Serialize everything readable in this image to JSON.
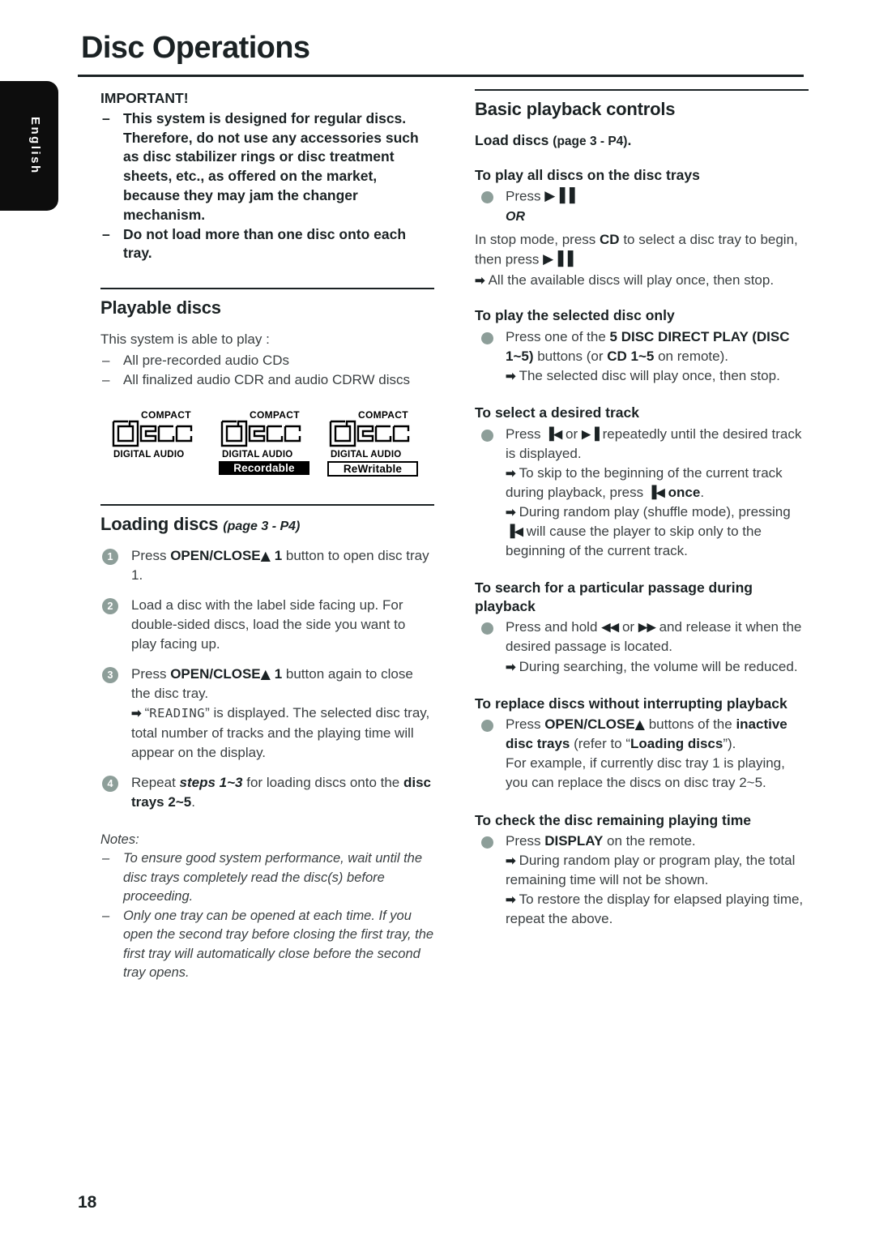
{
  "page": {
    "title": "Disc Operations",
    "language_tab": "English",
    "page_number": "18"
  },
  "left_column": {
    "important": {
      "heading": "IMPORTANT!",
      "items": [
        "This system is designed for regular discs. Therefore, do not use any accessories such as disc stabilizer rings or disc treatment sheets, etc., as offered on the market, because they may jam the changer mechanism.",
        "Do not load more than one disc onto each tray."
      ]
    },
    "playable_discs": {
      "heading": "Playable discs",
      "intro": "This system is able to play :",
      "items": [
        "All pre-recorded audio CDs",
        "All finalized audio CDR and audio CDRW discs"
      ],
      "logos": [
        {
          "top": "COMPACT",
          "word": "disc",
          "bottom": "DIGITAL AUDIO",
          "badge": "",
          "badge_style": "none"
        },
        {
          "top": "COMPACT",
          "word": "disc",
          "bottom": "DIGITAL AUDIO",
          "badge": "Recordable",
          "badge_style": "filled"
        },
        {
          "top": "COMPACT",
          "word": "disc",
          "bottom": "DIGITAL AUDIO",
          "badge": "ReWritable",
          "badge_style": "outline"
        }
      ]
    },
    "loading_discs": {
      "heading": "Loading discs",
      "heading_ref": "(page 3 - P4)",
      "steps": [
        {
          "num": "1",
          "pre": "Press ",
          "bold": "OPEN/CLOSE",
          "eject": "▲",
          "bold2": " 1",
          "post": " button to open disc tray 1."
        },
        {
          "num": "2",
          "text": "Load a disc with the label side facing up. For double-sided discs, load the side you want to play facing up."
        },
        {
          "num": "3",
          "pre": "Press ",
          "bold": "OPEN/CLOSE",
          "eject": "▲",
          "bold2": " 1",
          "post": " button again to close the disc tray.",
          "arrow_pre": "“",
          "arrow_lcd": "READING",
          "arrow_post": "” is displayed. The selected disc tray, total number of tracks and the playing time will appear on the display."
        },
        {
          "num": "4",
          "pre": "Repeat ",
          "bold_ital": "steps 1~3",
          "mid": " for loading discs onto the ",
          "bold2": "disc trays 2~5",
          "post": "."
        }
      ],
      "notes_label": "Notes:",
      "notes": [
        "To ensure good system performance, wait until the disc trays completely read the disc(s) before proceeding.",
        "Only one tray can be opened at each time. If you open the second tray before closing the first tray, the first tray will automatically close before the second tray opens."
      ]
    }
  },
  "right_column": {
    "basic_playback": {
      "heading": "Basic playback controls",
      "load_discs_bold": "Load discs",
      "load_discs_ref": "(page 3 - P4)",
      "load_discs_tail": "."
    },
    "sections": [
      {
        "heading": "To play all discs on the disc trays",
        "bullet_pre": "Press ",
        "bullet_glyph": "▶▐▐",
        "or_text": "OR",
        "para_pre": "In stop mode, press ",
        "para_bold": "CD",
        "para_mid": " to select a disc tray to begin, then press ",
        "para_glyph": "▶▐▐",
        "arrow1": "All the available discs will play once, then stop."
      },
      {
        "heading": "To play the selected disc only",
        "bullet_pre": "Press one of the ",
        "bullet_bold1": "5 DISC DIRECT PLAY (DISC 1~5)",
        "bullet_mid": " buttons (or ",
        "bullet_bold2": "CD 1~5",
        "bullet_post": " on remote).",
        "arrow1": "The selected disc will play once, then stop."
      },
      {
        "heading": "To select a desired track",
        "bullet_pre": "Press ",
        "glyph_prev": "▐◀",
        "bullet_mid": " or ",
        "glyph_next": "▶▐",
        "bullet_post": " repeatedly until the desired track is displayed.",
        "arrow1_pre": "To skip to the beginning of the current track during playback, press ",
        "arrow1_glyph": "▐◀",
        "arrow1_bold": " once",
        "arrow1_post": ".",
        "arrow2_pre": "During random play (shuffle mode), pressing ",
        "arrow2_glyph": "▐◀",
        "arrow2_post": " will cause the player to skip only to the beginning of the current track."
      },
      {
        "heading": "To search for a particular passage during playback",
        "bullet_pre": "Press and hold ",
        "glyph_rew": "◀◀",
        "bullet_mid": " or ",
        "glyph_ff": "▶▶",
        "bullet_post": " and release it when the desired passage is located.",
        "arrow1": "During searching, the volume will be reduced."
      },
      {
        "heading": "To replace discs without interrupting playback",
        "bullet_pre": "Press ",
        "bullet_bold1": "OPEN/CLOSE",
        "bullet_eject": "▲",
        "bullet_mid": " buttons of the ",
        "bullet_bold2": "inactive disc trays",
        "bullet_mid2": " (refer to “",
        "bullet_bold3": "Loading discs",
        "bullet_post": "”).",
        "para": "For example, if currently disc tray 1 is playing, you can replace the discs on disc tray 2~5."
      },
      {
        "heading": "To check the disc remaining playing time",
        "bullet_pre": "Press ",
        "bullet_bold1": "DISPLAY",
        "bullet_post": " on the remote.",
        "arrow1": "During random play or program play, the total remaining time will not be shown.",
        "arrow2": "To restore the display for elapsed playing time, repeat the above."
      }
    ]
  },
  "colors": {
    "bullet": "#8d9e99",
    "text": "#3a3f41",
    "heading": "#1b2224",
    "tab_bg": "#0d0d0d"
  }
}
